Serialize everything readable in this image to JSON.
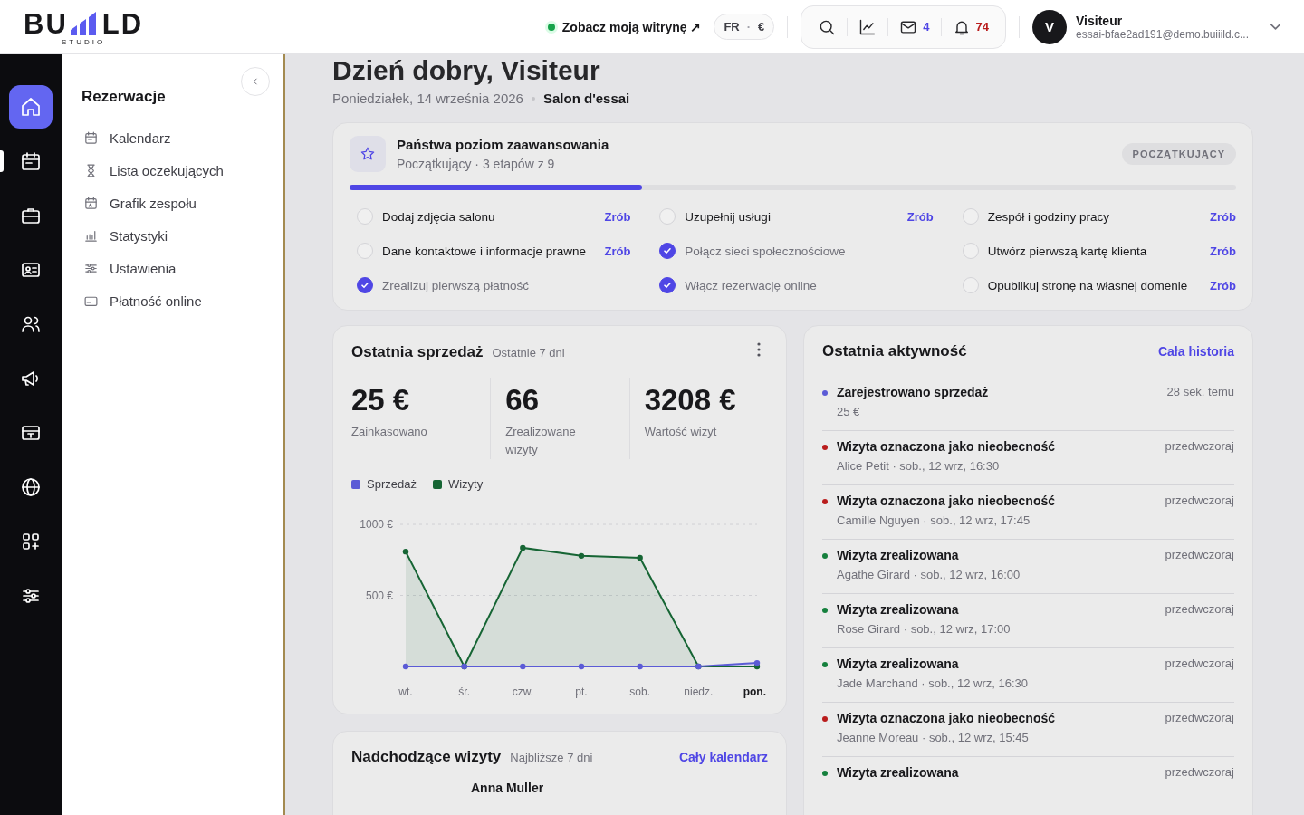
{
  "header": {
    "logo": {
      "left": "BU",
      "right": "LD",
      "tagline": "STUDIO"
    },
    "site_link": {
      "label": "Zobacz moją witrynę ↗",
      "online": true
    },
    "locale": {
      "language": "FR",
      "separator": "·",
      "currency": "€"
    },
    "messages_count": "4",
    "notifications_count": "74",
    "user": {
      "initial": "V",
      "name": "Visiteur",
      "email": "essai-bfae2ad191@demo.buiiild.c..."
    }
  },
  "rail": [
    {
      "selected": true,
      "current": false
    },
    {
      "selected": false,
      "current": true
    },
    {
      "selected": false,
      "current": false
    },
    {
      "selected": false,
      "current": false
    },
    {
      "selected": false,
      "current": false
    },
    {
      "selected": false,
      "current": false
    },
    {
      "selected": false,
      "current": false
    },
    {
      "selected": false,
      "current": false
    },
    {
      "selected": false,
      "current": false
    },
    {
      "selected": false,
      "current": false
    }
  ],
  "sidebar": {
    "title": "Rezerwacje",
    "items": [
      {
        "label": "Kalendarz"
      },
      {
        "label": "Lista oczekujących"
      },
      {
        "label": "Grafik zespołu"
      },
      {
        "label": "Statystyki"
      },
      {
        "label": "Ustawienia"
      },
      {
        "label": "Płatność online"
      }
    ]
  },
  "greeting": "Dzień dobry, Visiteur",
  "date": "Poniedziałek, 14 września 2026",
  "salon": "Salon d'essai",
  "progress": {
    "title": "Państwa poziom zaawansowania",
    "subtitle": "Początkujący · 3 etapów z 9",
    "badge": "POCZĄTKUJĄCY",
    "level": 0.33,
    "tasks": [
      {
        "label": "Dodaj zdjęcia salonu",
        "checked": false,
        "action": "Zrób"
      },
      {
        "label": "Uzupełnij usługi",
        "checked": false,
        "action": "Zrób"
      },
      {
        "label": "Zespół i godziny pracy",
        "checked": false,
        "action": "Zrób"
      },
      {
        "label": "Dane kontaktowe i informacje prawne",
        "checked": false,
        "action": "Zrób"
      },
      {
        "label": "Połącz sieci społecznościowe",
        "checked": true
      },
      {
        "label": "Utwórz pierwszą kartę klienta",
        "checked": false,
        "action": "Zrób"
      },
      {
        "label": "Zrealizuj pierwszą płatność",
        "checked": true
      },
      {
        "label": "Włącz rezerwację online",
        "checked": true
      },
      {
        "label": "Opublikuj stronę na własnej domenie",
        "checked": false,
        "action": "Zrób"
      }
    ]
  },
  "sales": {
    "title": "Ostatnia sprzedaż",
    "period": "Ostatnie 7 dni",
    "stats": [
      {
        "value": "25 €",
        "label": "Zainkasowano"
      },
      {
        "value": "66",
        "label": "Zrealizowane wizyty"
      },
      {
        "value": "3208 €",
        "label": "Wartość wizyt"
      }
    ],
    "chart_data": {
      "type": "area",
      "categories": [
        "wt.",
        "śr.",
        "czw.",
        "pt.",
        "sob.",
        "niedz.",
        "pon."
      ],
      "ylim": [
        0,
        1000
      ],
      "yticks": [
        {
          "value": 500,
          "label": "500 €"
        },
        {
          "value": 1000,
          "label": "1000 €"
        }
      ],
      "series": [
        {
          "name": "Sprzedaż",
          "color": "#5b5bd6",
          "values": [
            0,
            0,
            0,
            0,
            0,
            0,
            25
          ]
        },
        {
          "name": "Wizyty",
          "color": "#166534",
          "values": [
            808,
            0,
            835,
            778,
            764,
            0,
            0
          ]
        }
      ]
    }
  },
  "upcoming": {
    "title": "Nadchodzące wizyty",
    "period": "Najbliższe 7 dni",
    "link": "Cały kalendarz",
    "first_client": "Anna Muller"
  },
  "activity": {
    "title": "Ostatnia aktywność",
    "link": "Cała historia",
    "items": [
      {
        "title": "Zarejestrowano sprzedaż",
        "detail": "25 €",
        "time": "28 sek. temu",
        "color": "#5b5bd6"
      },
      {
        "title": "Wizyta oznaczona jako nieobecność",
        "detail": "Alice Petit · sob., 12 wrz, 16:30",
        "time": "przedwczoraj",
        "color": "#b91c1c"
      },
      {
        "title": "Wizyta oznaczona jako nieobecność",
        "detail": "Camille Nguyen · sob., 12 wrz, 17:45",
        "time": "przedwczoraj",
        "color": "#b91c1c"
      },
      {
        "title": "Wizyta zrealizowana",
        "detail": "Agathe Girard · sob., 12 wrz, 16:00",
        "time": "przedwczoraj",
        "color": "#15803d"
      },
      {
        "title": "Wizyta zrealizowana",
        "detail": "Rose Girard · sob., 12 wrz, 17:00",
        "time": "przedwczoraj",
        "color": "#15803d"
      },
      {
        "title": "Wizyta zrealizowana",
        "detail": "Jade Marchand · sob., 12 wrz, 16:30",
        "time": "przedwczoraj",
        "color": "#15803d"
      },
      {
        "title": "Wizyta oznaczona jako nieobecność",
        "detail": "Jeanne Moreau · sob., 12 wrz, 15:45",
        "time": "przedwczoraj",
        "color": "#b91c1c"
      },
      {
        "title": "Wizyta zrealizowana",
        "time": "przedwczoraj",
        "color": "#15803d"
      }
    ]
  }
}
